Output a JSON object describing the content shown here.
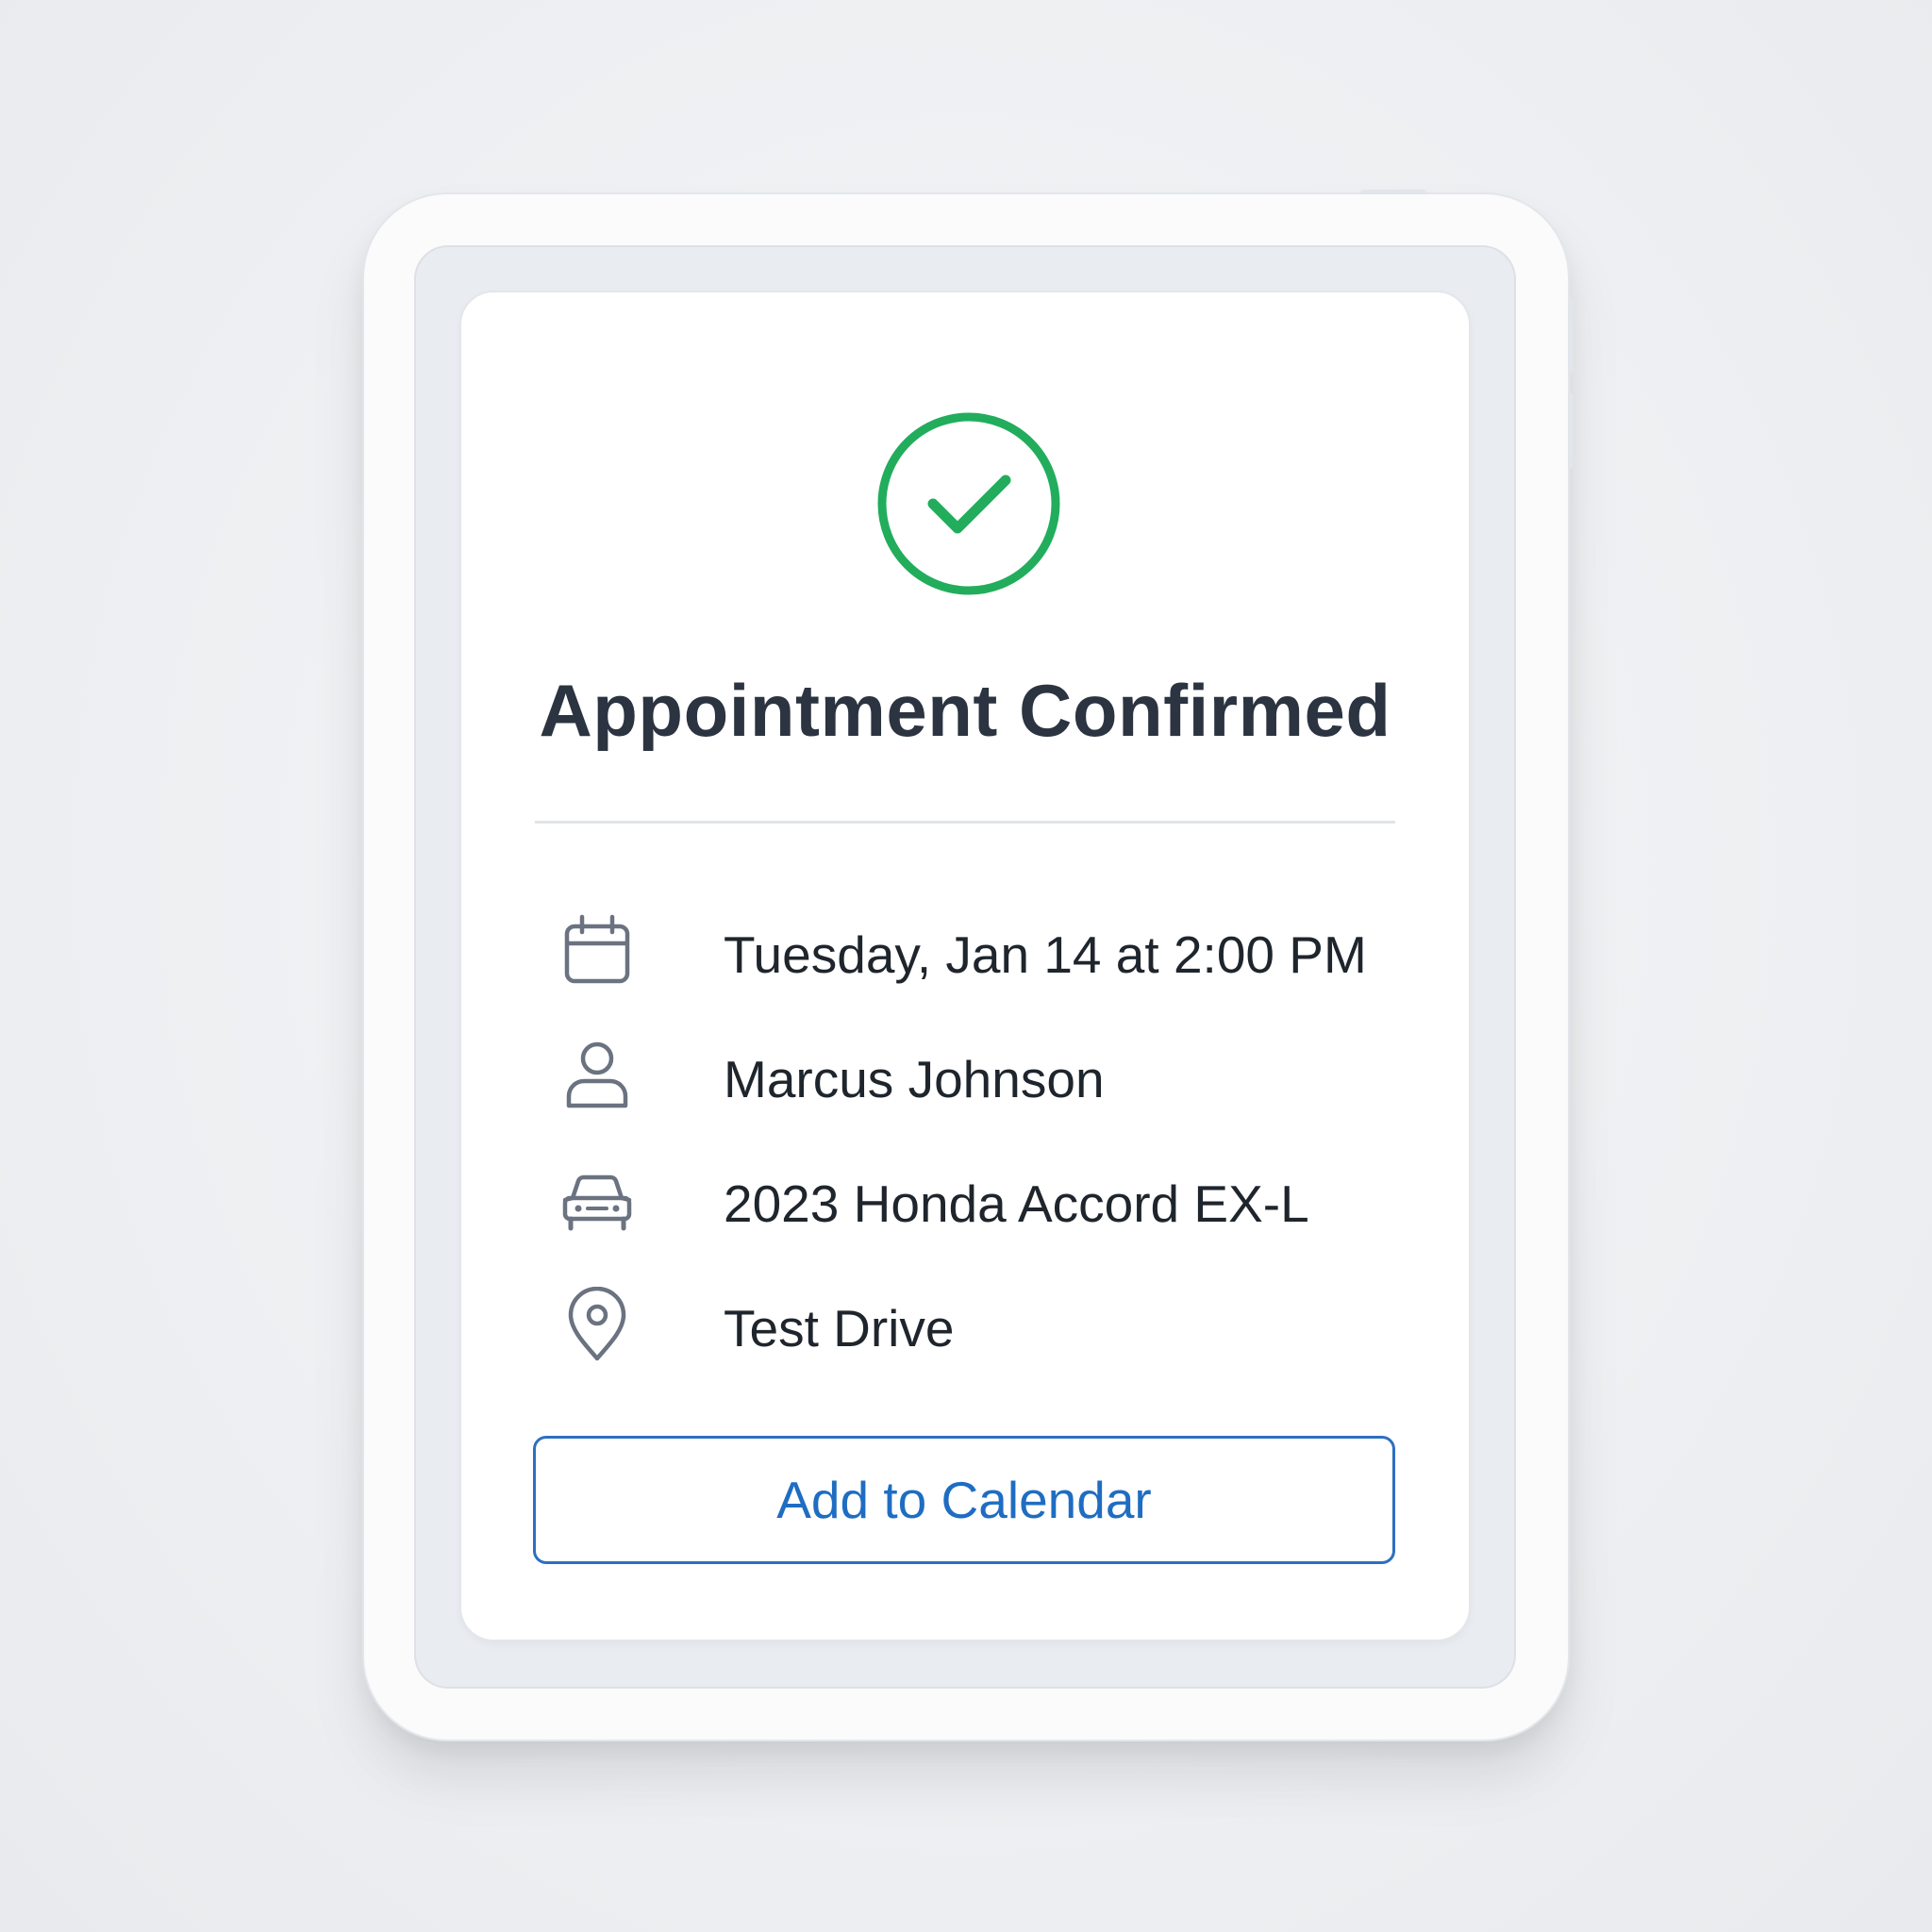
{
  "confirmation": {
    "title": "Appointment Confirmed",
    "status_icon": "check-circle-icon",
    "success_color": "#22ad5c",
    "details": [
      {
        "icon": "calendar-icon",
        "text": "Tuesday, Jan 14 at 2:00 PM"
      },
      {
        "icon": "person-icon",
        "text": "Marcus Johnson"
      },
      {
        "icon": "car-icon",
        "text": "2023 Honda Accord EX-L"
      },
      {
        "icon": "location-pin-icon",
        "text": "Test Drive"
      }
    ],
    "add_to_calendar_label": "Add to Calendar",
    "accent_color": "#1f6dc2",
    "icon_color": "#6b7280"
  }
}
